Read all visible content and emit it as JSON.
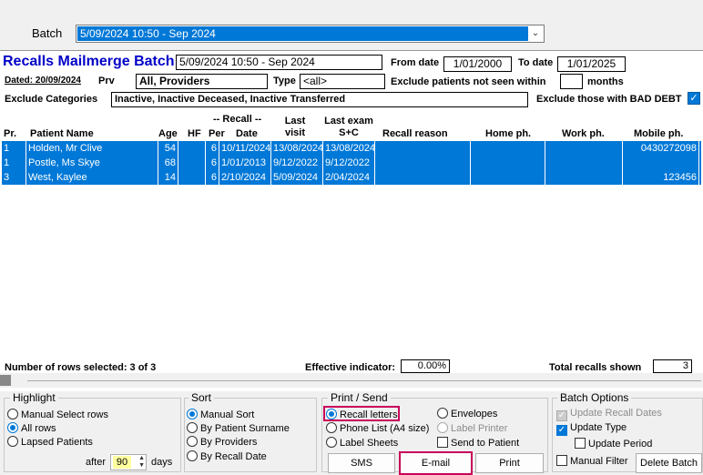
{
  "batch_bar": {
    "label": "Batch",
    "selected": "5/09/2024 10:50 - Sep 2024"
  },
  "header": {
    "title": "Recalls Mailmerge Batch",
    "batch_name": "5/09/2024 10:50 - Sep 2024",
    "from_date_label": "From date",
    "from_date": "1/01/2000",
    "to_date_label": "To date",
    "to_date": "1/01/2025",
    "dated_label": "Dated:",
    "dated_value": "20/09/2024",
    "prv_label": "Prv",
    "prv_value": "All,  Providers",
    "type_label": "Type",
    "type_value": "<all>",
    "exclude_not_seen_label": "Exclude patients not seen within",
    "exclude_not_seen_value": "",
    "months_label": "months",
    "exclude_categories_label": "Exclude Categories",
    "exclude_categories_value": "Inactive, Inactive Deceased, Inactive Transferred",
    "exclude_bad_debt_label": "Exclude those with BAD DEBT"
  },
  "table": {
    "columns": {
      "pr": "Pr.",
      "patient_name": "Patient Name",
      "age": "Age",
      "hf": "HF",
      "recall_group": "-- Recall --",
      "per": "Per",
      "date": "Date",
      "last_visit": "Last\nvisit",
      "last_exam": "Last exam\nS+C",
      "recall_reason": "Recall reason",
      "home_ph": "Home ph.",
      "work_ph": "Work ph.",
      "mobile_ph": "Mobile ph."
    },
    "rows": [
      {
        "pr": "1",
        "name": "Holden, Mr Clive",
        "age": "54",
        "hf": "",
        "per": "6",
        "date": "10/11/2024",
        "last_visit": "13/08/2024",
        "last_exam": "13/08/2024",
        "reason": "",
        "home": "",
        "work": "",
        "mobile": "0430272098"
      },
      {
        "pr": "1",
        "name": "Postle, Ms Skye",
        "age": "68",
        "hf": "",
        "per": "6",
        "date": "1/01/2013",
        "last_visit": "9/12/2022",
        "last_exam": "9/12/2022",
        "reason": "",
        "home": "",
        "work": "",
        "mobile": ""
      },
      {
        "pr": "3",
        "name": "West,  Kaylee",
        "age": "14",
        "hf": "",
        "per": "6",
        "date": "2/10/2024",
        "last_visit": "5/09/2024",
        "last_exam": "2/04/2024",
        "reason": "",
        "home": "",
        "work": "",
        "mobile": "123456"
      }
    ]
  },
  "status": {
    "rows_selected": "Number of rows selected: 3 of 3",
    "effective_label": "Effective indicator:",
    "effective_value": "0.00%",
    "total_label": "Total recalls shown",
    "total_value": "3"
  },
  "highlight": {
    "title": "Highlight",
    "manual": "Manual Select rows",
    "all": "All rows",
    "lapsed": "Lapsed Patients",
    "after_label": "after",
    "after_value": "90",
    "days_label": "days"
  },
  "sort": {
    "title": "Sort",
    "manual": "Manual Sort",
    "surname": "By Patient Surname",
    "providers": "By Providers",
    "recall_date": "By Recall Date"
  },
  "print_send": {
    "title": "Print / Send",
    "recall_letters": "Recall letters",
    "phone_list": "Phone List (A4 size)",
    "label_sheets": "Label Sheets",
    "envelopes": "Envelopes",
    "label_printer": "Label Printer",
    "send_to_patient": "Send to Patient",
    "sms": "SMS",
    "email": "E-mail",
    "print": "Print"
  },
  "batch_options": {
    "title": "Batch Options",
    "update_recall_dates": "Update Recall Dates",
    "update_type": "Update Type",
    "update_period": "Update Period",
    "manual_filter": "Manual Filter",
    "delete_batch": "Delete Batch"
  }
}
